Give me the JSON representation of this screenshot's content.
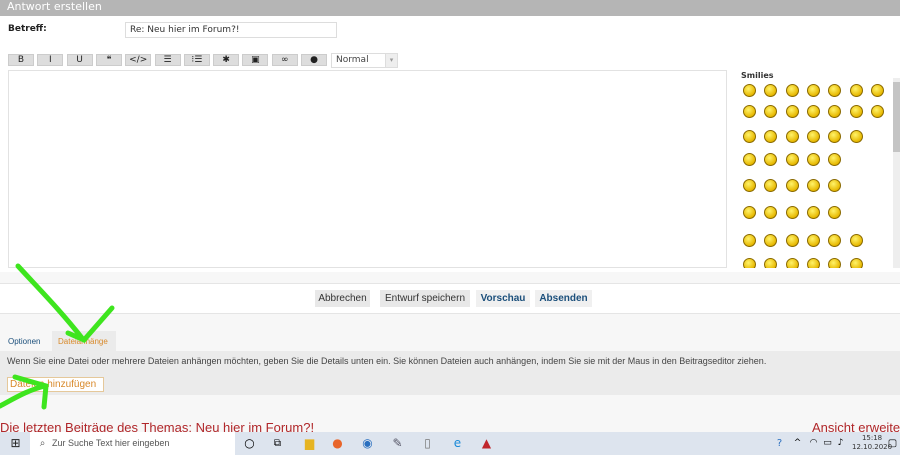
{
  "header": {
    "title": "Antwort erstellen"
  },
  "form": {
    "subject_label": "Betreff:",
    "subject_value": "Re: Neu hier im Forum?!"
  },
  "toolbar": {
    "buttons": [
      {
        "icon": "bold-icon",
        "glyph": "B"
      },
      {
        "icon": "italic-icon",
        "glyph": "I"
      },
      {
        "icon": "underline-icon",
        "glyph": "U"
      },
      {
        "icon": "quote-icon",
        "glyph": "❝"
      },
      {
        "icon": "code-icon",
        "glyph": "</>"
      },
      {
        "icon": "bullet-list-icon",
        "glyph": "☰"
      },
      {
        "icon": "numbered-list-icon",
        "glyph": "⁝☰"
      },
      {
        "icon": "asterisk-icon",
        "glyph": "✱"
      },
      {
        "icon": "image-icon",
        "glyph": "▣"
      },
      {
        "icon": "link-icon",
        "glyph": "∞"
      },
      {
        "icon": "color-drop-icon",
        "glyph": "●"
      }
    ],
    "font_size": "Normal"
  },
  "smilies": {
    "title": "Smilies",
    "rows": [
      7,
      7,
      6,
      5,
      5,
      5,
      6,
      6
    ]
  },
  "actions": {
    "cancel": "Abbrechen",
    "draft": "Entwurf speichern",
    "preview": "Vorschau",
    "submit": "Absenden"
  },
  "tabs": {
    "options": "Optionen",
    "attachments": "Dateianhänge"
  },
  "attachments": {
    "info": "Wenn Sie eine Datei oder mehrere Dateien anhängen möchten, geben Sie die Details unten ein. Sie können Dateien auch anhängen, indem Sie sie mit der Maus in den Beitragseditor ziehen.",
    "add_button": "Dateien hinzufügen"
  },
  "recent": {
    "title": "Die letzten Beiträge des Themas: Neu hier im Forum?!",
    "expand": "Ansicht erweitern"
  },
  "taskbar": {
    "search_placeholder": "Zur Suche Text hier eingeben",
    "time": "15:18",
    "date": "12.10.2020"
  },
  "colors": {
    "accent": "#1b4f7b",
    "active_tab": "#d8892a",
    "heading_red": "#b0272a",
    "annotation_arrow": "#3ee51e"
  }
}
